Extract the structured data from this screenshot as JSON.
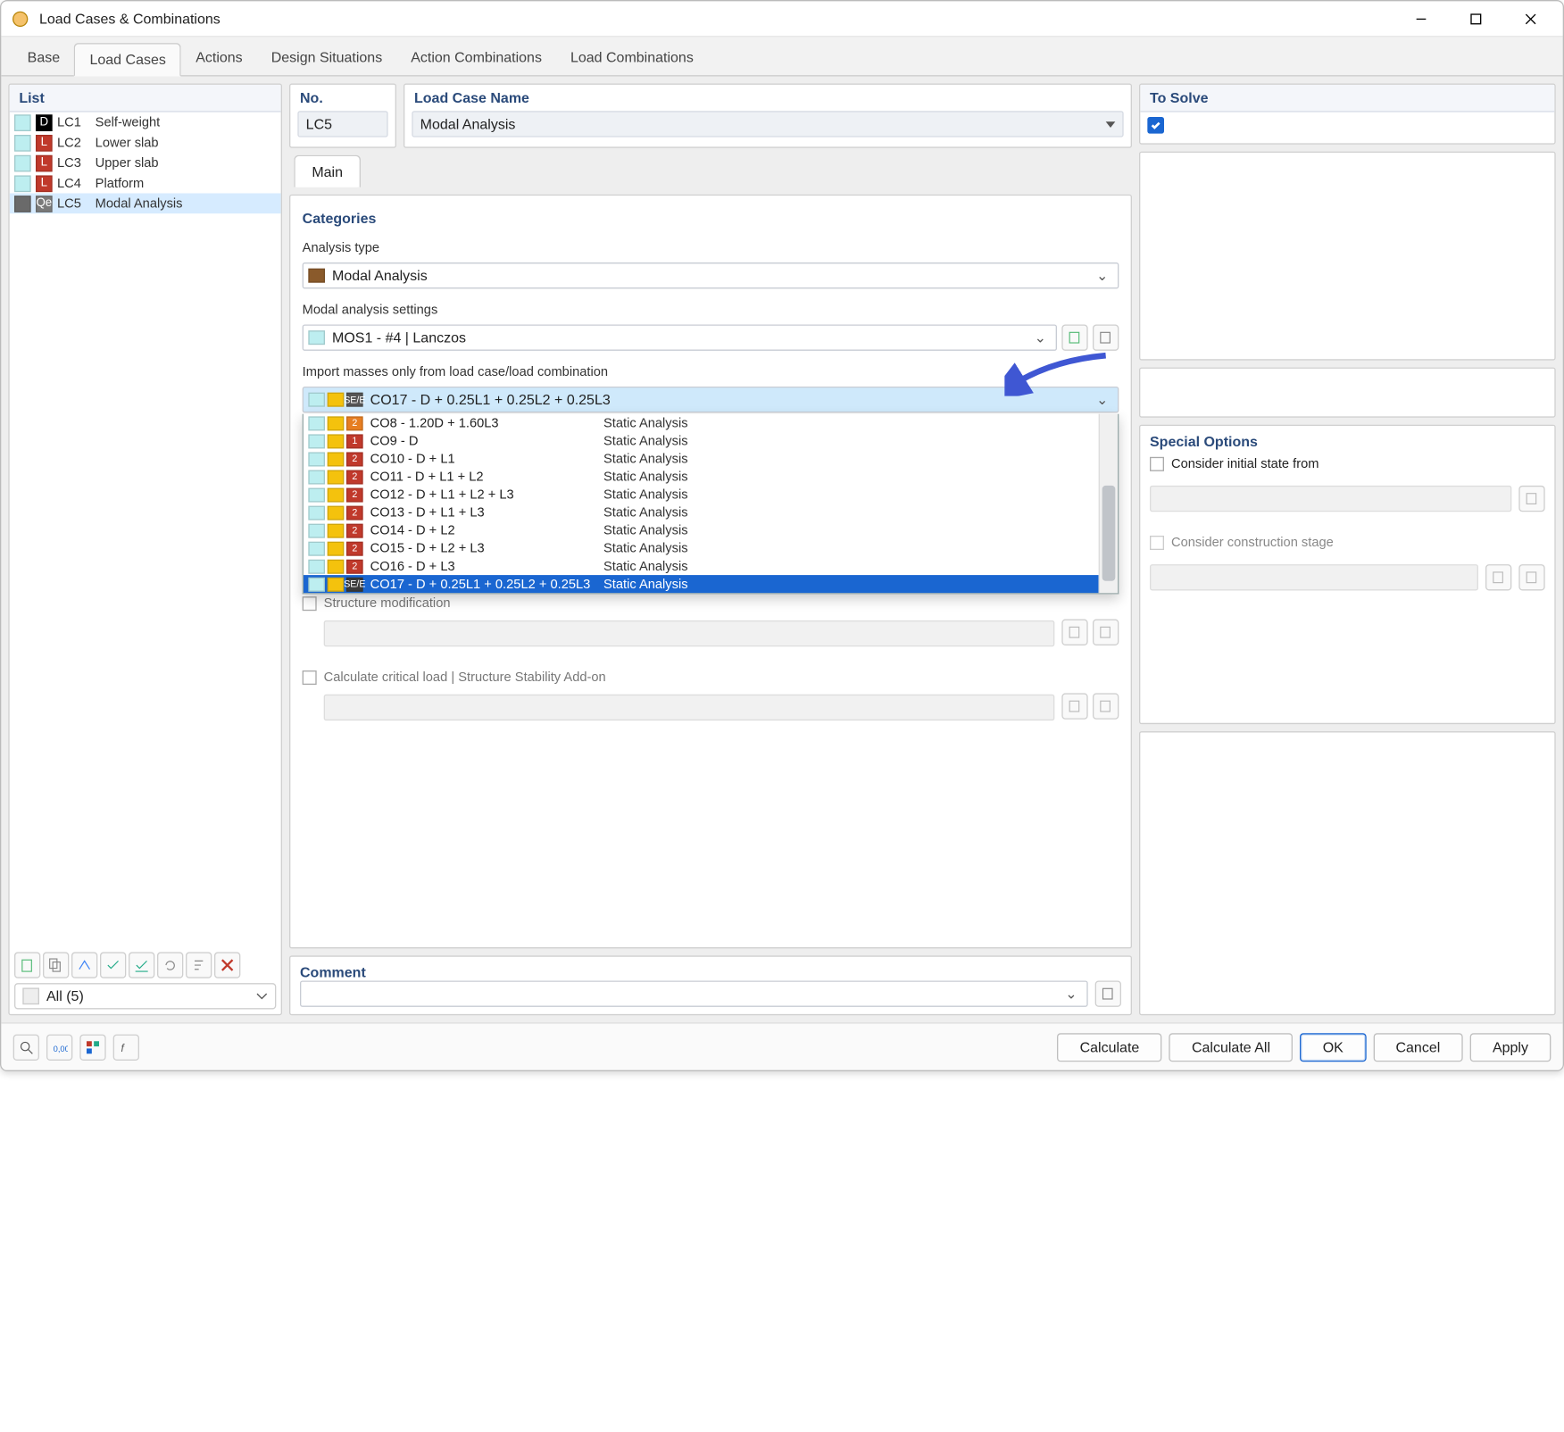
{
  "window": {
    "title": "Load Cases & Combinations"
  },
  "tabs": [
    "Base",
    "Load Cases",
    "Actions",
    "Design Situations",
    "Action Combinations",
    "Load Combinations"
  ],
  "active_tab": "Load Cases",
  "list": {
    "title": "List",
    "items": [
      {
        "id": "LC1",
        "name": "Self-weight",
        "cat": "D",
        "color": "black"
      },
      {
        "id": "LC2",
        "name": "Lower slab",
        "cat": "L",
        "color": "red"
      },
      {
        "id": "LC3",
        "name": "Upper slab",
        "cat": "L",
        "color": "red"
      },
      {
        "id": "LC4",
        "name": "Platform",
        "cat": "L",
        "color": "red"
      },
      {
        "id": "LC5",
        "name": "Modal Analysis",
        "cat": "Qe",
        "color": "grey",
        "selected": true
      }
    ],
    "filter": "All (5)"
  },
  "form": {
    "no_label": "No.",
    "no_value": "LC5",
    "name_label": "Load Case Name",
    "name_value": "Modal Analysis",
    "main_tab": "Main",
    "categories": "Categories",
    "analysis_type_label": "Analysis type",
    "analysis_type_value": "Modal Analysis",
    "modal_settings_label": "Modal analysis settings",
    "modal_settings_value": "MOS1 - #4 | Lanczos",
    "import_label": "Import masses only from load case/load combination",
    "import_value": "CO17 - D + 0.25L1 + 0.25L2 + 0.25L3",
    "structure_mod": "Structure modification",
    "critical_load": "Calculate critical load | Structure Stability Add-on"
  },
  "dropdown": [
    {
      "badge": "2",
      "color": "orange",
      "name": "CO8 - 1.20D + 1.60L3",
      "type": "Static Analysis"
    },
    {
      "badge": "1",
      "color": "red",
      "name": "CO9 - D",
      "type": "Static Analysis"
    },
    {
      "badge": "2",
      "color": "red",
      "name": "CO10 - D + L1",
      "type": "Static Analysis"
    },
    {
      "badge": "2",
      "color": "red",
      "name": "CO11 - D + L1 + L2",
      "type": "Static Analysis"
    },
    {
      "badge": "2",
      "color": "red",
      "name": "CO12 - D + L1 + L2 + L3",
      "type": "Static Analysis"
    },
    {
      "badge": "2",
      "color": "red",
      "name": "CO13 - D + L1 + L3",
      "type": "Static Analysis"
    },
    {
      "badge": "2",
      "color": "red",
      "name": "CO14 - D + L2",
      "type": "Static Analysis"
    },
    {
      "badge": "2",
      "color": "red",
      "name": "CO15 - D + L2 + L3",
      "type": "Static Analysis"
    },
    {
      "badge": "2",
      "color": "red",
      "name": "CO16 - D + L3",
      "type": "Static Analysis"
    },
    {
      "badge": "SE/E",
      "color": "dgrey",
      "name": "CO17 - D + 0.25L1 + 0.25L2 + 0.25L3",
      "type": "Static Analysis",
      "selected": true
    }
  ],
  "solve": {
    "title": "To Solve"
  },
  "special": {
    "title": "Special Options",
    "initial_state": "Consider initial state from",
    "construction_stage": "Consider construction stage"
  },
  "comment": {
    "title": "Comment"
  },
  "footer": {
    "calculate": "Calculate",
    "calculate_all": "Calculate All",
    "ok": "OK",
    "cancel": "Cancel",
    "apply": "Apply"
  }
}
